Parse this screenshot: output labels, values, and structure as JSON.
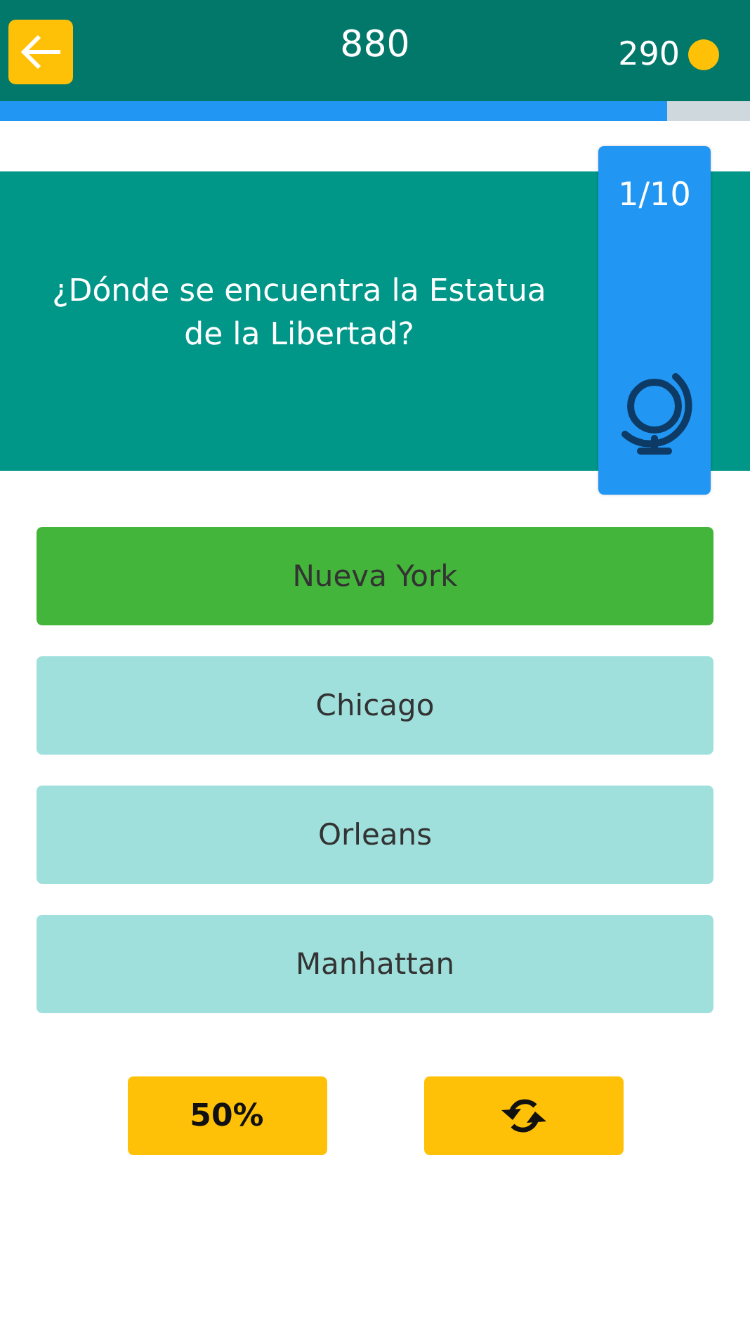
{
  "header": {
    "score": "880",
    "coins": "290"
  },
  "progress": {
    "level": 0.89
  },
  "question": {
    "text": "¿Dónde se encuentra la Estatua de la Libertad?",
    "counter": "1/10"
  },
  "answers": [
    {
      "label": "Nueva York",
      "correct": true
    },
    {
      "label": "Chicago",
      "correct": false
    },
    {
      "label": "Orleans",
      "correct": false
    },
    {
      "label": "Manhattan",
      "correct": false
    }
  ],
  "lifelines": [
    {
      "kind": "text",
      "label": "50%"
    },
    {
      "kind": "swap"
    }
  ]
}
